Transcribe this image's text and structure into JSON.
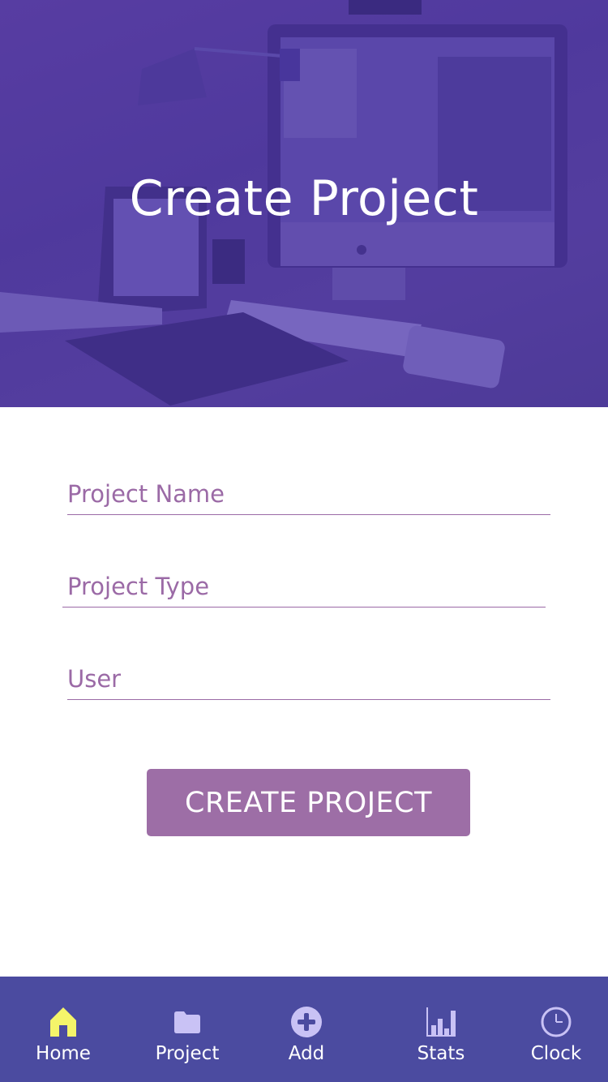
{
  "header": {
    "title": "Create Project"
  },
  "form": {
    "project_name": {
      "placeholder": "Project Name",
      "value": ""
    },
    "project_type": {
      "placeholder": "Project Type",
      "value": ""
    },
    "user": {
      "placeholder": "User",
      "value": ""
    },
    "submit_label": "CREATE PROJECT"
  },
  "nav": {
    "items": [
      {
        "label": "Home",
        "icon": "home-icon",
        "active": true
      },
      {
        "label": "Project",
        "icon": "folder-icon",
        "active": false
      },
      {
        "label": "Add",
        "icon": "plus-circle-icon",
        "active": false
      },
      {
        "label": "Stats",
        "icon": "bar-chart-icon",
        "active": false
      },
      {
        "label": "Clock",
        "icon": "clock-icon",
        "active": false
      }
    ]
  },
  "colors": {
    "hero_overlay": "#543aa0",
    "accent": "#9d6ea6",
    "nav_background": "#4b4ba0",
    "nav_active_icon": "#f4f46a",
    "nav_icon": "#c9c2f5"
  }
}
